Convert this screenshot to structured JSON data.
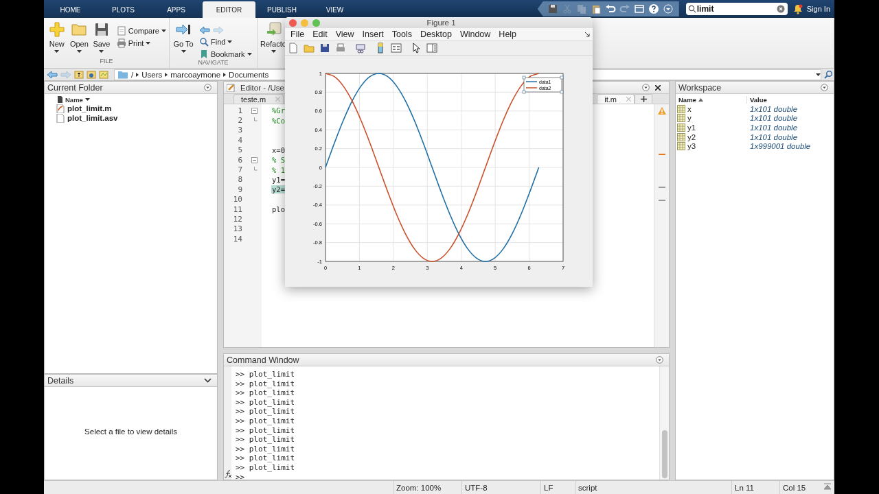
{
  "app_tabs": [
    {
      "label": "HOME",
      "selected": false
    },
    {
      "label": "PLOTS",
      "selected": false
    },
    {
      "label": "APPS",
      "selected": false
    },
    {
      "label": "EDITOR",
      "selected": true
    },
    {
      "label": "PUBLISH",
      "selected": false
    },
    {
      "label": "VIEW",
      "selected": false
    }
  ],
  "quick_access": {
    "buttons": [
      {
        "kind": "save",
        "disabled": false
      },
      {
        "kind": "cut",
        "disabled": true
      },
      {
        "kind": "copy",
        "disabled": true
      },
      {
        "kind": "paste",
        "disabled": false
      },
      {
        "kind": "undo",
        "disabled": false
      },
      {
        "kind": "redo",
        "disabled": true
      },
      {
        "kind": "windows",
        "disabled": false
      },
      {
        "kind": "help",
        "disabled": false
      },
      {
        "kind": "more",
        "disabled": false
      }
    ],
    "search": {
      "value": "limit"
    },
    "sign_in": "Sign In"
  },
  "toolstrip": {
    "sections": [
      {
        "label": "FILE",
        "buttons": [
          {
            "label": "New",
            "kind": "new"
          },
          {
            "label": "Open",
            "kind": "open"
          },
          {
            "label": "Save",
            "kind": "save"
          },
          {
            "label": "Compare",
            "kind": "compare"
          },
          {
            "label": "Print",
            "kind": "print"
          }
        ]
      },
      {
        "label": "NAVIGATE",
        "nav": [
          {
            "kind": "back",
            "disabled": false
          },
          {
            "kind": "forward",
            "disabled": true
          }
        ],
        "buttons": [
          {
            "label": "Go To",
            "kind": "goto"
          },
          {
            "label": "Find",
            "kind": "find"
          },
          {
            "label": "Bookmark",
            "kind": "bookmark"
          }
        ]
      },
      {
        "buttons": [
          {
            "label": "Refacto",
            "kind": "refactor"
          }
        ]
      }
    ]
  },
  "address_bar": {
    "nav": [
      {
        "kind": "back",
        "disabled": false
      },
      {
        "kind": "forward",
        "disabled": true
      }
    ],
    "path": [
      "/",
      "Users",
      "marcoaymone",
      "Documents"
    ]
  },
  "current_folder": {
    "title": "Current Folder",
    "column": "Name",
    "files": [
      {
        "name": "plot_limit.m",
        "kind": "script"
      },
      {
        "name": "plot_limit.asv",
        "kind": "file"
      }
    ]
  },
  "details": {
    "title": "Details",
    "message": "Select a file to view details"
  },
  "editor": {
    "title": "Editor - /Use",
    "tabs": [
      {
        "label": "teste.m",
        "selected": false
      },
      {
        "label": "it.m",
        "selected": true
      }
    ],
    "lines": [
      {
        "number": "1",
        "code": "%Gr",
        "kind": "comment",
        "fold_start": true,
        "fold_end": false,
        "highlighted": false
      },
      {
        "number": "2",
        "code": "%Co",
        "kind": "comment",
        "fold_start": false,
        "fold_end": true,
        "highlighted": false
      },
      {
        "number": "3",
        "fold_start": false,
        "fold_end": false,
        "highlighted": false
      },
      {
        "number": "4",
        "fold_start": false,
        "fold_end": false,
        "highlighted": false
      },
      {
        "number": "5",
        "code": "x=0",
        "kind": "code",
        "fold_start": false,
        "fold_end": false,
        "highlighted": false
      },
      {
        "number": "6",
        "code": "% S",
        "kind": "comment",
        "fold_start": true,
        "fold_end": false,
        "highlighted": false
      },
      {
        "number": "7",
        "code": "% 1",
        "kind": "comment",
        "fold_start": false,
        "fold_end": true,
        "highlighted": false
      },
      {
        "number": "8",
        "code": "y1=",
        "kind": "code",
        "fold_start": false,
        "fold_end": false,
        "highlighted": false
      },
      {
        "number": "9",
        "code": "y2=",
        "kind": "code",
        "fold_start": false,
        "fold_end": false,
        "highlighted": true
      },
      {
        "number": "10",
        "fold_start": false,
        "fold_end": false,
        "highlighted": false
      },
      {
        "number": "11",
        "code": "plo",
        "kind": "code",
        "fold_start": false,
        "fold_end": false,
        "highlighted": false
      },
      {
        "number": "12",
        "fold_start": false,
        "fold_end": false,
        "highlighted": false
      },
      {
        "number": "13",
        "fold_start": false,
        "fold_end": false,
        "highlighted": false
      },
      {
        "number": "14",
        "fold_start": false,
        "fold_end": false,
        "highlighted": false
      }
    ],
    "markers": [
      {
        "kind": "summary"
      },
      {
        "kind": "warning"
      },
      {
        "kind": "note"
      },
      {
        "kind": "note"
      }
    ]
  },
  "figure": {
    "title": "Figure 1",
    "menu": [
      "File",
      "Edit",
      "View",
      "Insert",
      "Tools",
      "Desktop",
      "Window",
      "Help"
    ],
    "chart_data": {
      "type": "line",
      "x": [
        0,
        0.262,
        0.524,
        0.785,
        1.047,
        1.309,
        1.571,
        1.833,
        2.094,
        2.356,
        2.618,
        2.88,
        3.142,
        3.403,
        3.665,
        3.927,
        4.189,
        4.451,
        4.712,
        4.974,
        5.236,
        5.498,
        5.76,
        6.021,
        6.283
      ],
      "series": [
        {
          "name": "data1",
          "color": "#1f6fa6",
          "values": [
            0,
            0.259,
            0.5,
            0.707,
            0.866,
            0.966,
            1,
            0.966,
            0.866,
            0.707,
            0.5,
            0.259,
            0,
            -0.259,
            -0.5,
            -0.707,
            -0.866,
            -0.966,
            -1,
            -0.966,
            -0.866,
            -0.707,
            -0.5,
            -0.259,
            0
          ]
        },
        {
          "name": "data2",
          "color": "#c8502a",
          "values": [
            1,
            0.966,
            0.866,
            0.707,
            0.5,
            0.259,
            0,
            -0.259,
            -0.5,
            -0.707,
            -0.866,
            -0.966,
            -1,
            -0.966,
            -0.866,
            -0.707,
            -0.5,
            -0.259,
            0,
            0.259,
            0.5,
            0.707,
            0.866,
            0.966,
            1
          ]
        }
      ],
      "grid": true,
      "legend": true,
      "xlim": [
        0,
        7
      ],
      "ylim": [
        -1,
        1
      ],
      "xticks": [
        0,
        1,
        2,
        3,
        4,
        5,
        6,
        7
      ],
      "yticks": [
        -1,
        -0.8,
        -0.6,
        -0.4,
        -0.2,
        0,
        0.2,
        0.4,
        0.6,
        0.8,
        1
      ]
    }
  },
  "command_window": {
    "title": "Command Window",
    "history": [
      ">> plot_limit",
      ">> plot_limit",
      ">> plot_limit",
      ">> plot_limit",
      ">> plot_limit",
      ">> plot_limit",
      ">> plot_limit",
      ">> plot_limit",
      ">> plot_limit",
      ">> plot_limit",
      ">> plot_limit"
    ],
    "prompt": ">>"
  },
  "workspace": {
    "title": "Workspace",
    "columns": [
      "Name",
      "Value"
    ],
    "variables": [
      {
        "name": "x",
        "value": "1x101 double"
      },
      {
        "name": "y",
        "value": "1x101 double"
      },
      {
        "name": "y1",
        "value": "1x101 double"
      },
      {
        "name": "y2",
        "value": "1x101 double"
      },
      {
        "name": "y3",
        "value": "1x999001 double"
      }
    ]
  },
  "status_bar": {
    "zoom": "Zoom: 100%",
    "encoding": "UTF-8",
    "line_ending": "LF",
    "file_type": "script",
    "line": "Ln 11",
    "column": "Col 15"
  }
}
